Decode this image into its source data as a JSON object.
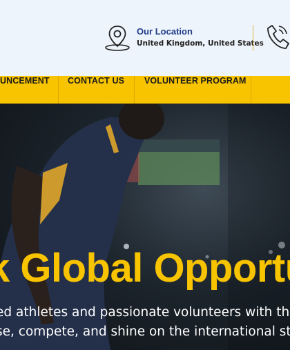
{
  "contact": {
    "location_title": "Our Location",
    "location_text": "United Kingdom, United States"
  },
  "nav": {
    "items": [
      {
        "label": "UNCEMENT"
      },
      {
        "label": "CONTACT US"
      },
      {
        "label": "VOLUNTEER PROGRAM"
      }
    ]
  },
  "hero": {
    "title": "k Global Opportu",
    "subtitle_line1": "ed athletes and passionate volunteers with the",
    "subtitle_line2": "se, compete, and shine on the international sta"
  },
  "colors": {
    "accent": "#f8c400",
    "topbar_bg": "#eef4fc",
    "heading_blue": "#1f3c88"
  },
  "icons": [
    "map-pin-icon",
    "phone-icon"
  ]
}
